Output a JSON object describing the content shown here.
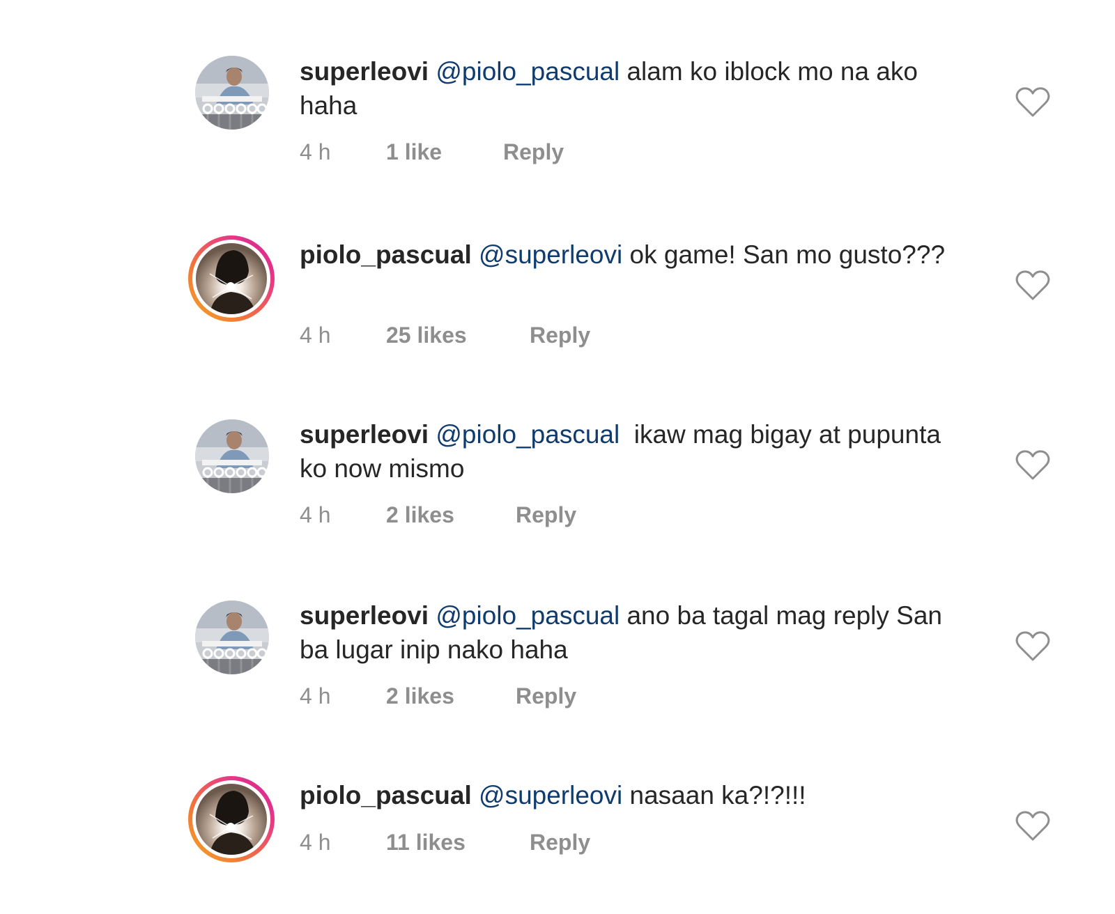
{
  "comments": [
    {
      "username": "superleovi",
      "mention": "@piolo_pascual",
      "text": " alam ko iblock mo na ako haha",
      "time": "4 h",
      "likes": "1 like",
      "reply": "Reply"
    },
    {
      "username": "piolo_pascual",
      "mention": "@superleovi",
      "text": " ok game! San mo gusto???",
      "time": "4 h",
      "likes": "25 likes",
      "reply": "Reply"
    },
    {
      "username": "superleovi",
      "mention": "@piolo_pascual",
      "text": "  ikaw mag bigay at pupunta ko now mismo",
      "time": "4 h",
      "likes": "2 likes",
      "reply": "Reply"
    },
    {
      "username": "superleovi",
      "mention": "@piolo_pascual",
      "text": " ano ba tagal mag reply San ba lugar inip nako haha",
      "time": "4 h",
      "likes": "2 likes",
      "reply": "Reply"
    },
    {
      "username": "piolo_pascual",
      "mention": "@superleovi",
      "text": " nasaan ka?!?!!!",
      "time": "4 h",
      "likes": "11 likes",
      "reply": "Reply"
    }
  ]
}
